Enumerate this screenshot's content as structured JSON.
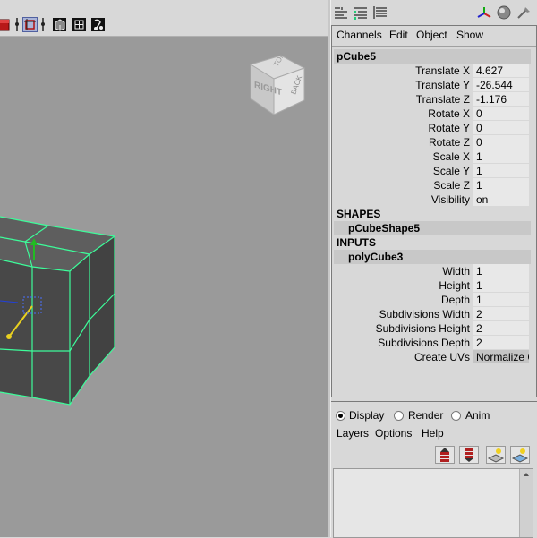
{
  "viewcube": {
    "face_label": "RIGHT"
  },
  "channel_box": {
    "menus": [
      "Channels",
      "Edit",
      "Object",
      "Show"
    ],
    "object_name": "pCube5",
    "transform_attrs": [
      {
        "label": "Translate X",
        "value": "4.627"
      },
      {
        "label": "Translate Y",
        "value": "-26.544"
      },
      {
        "label": "Translate Z",
        "value": "-1.176"
      },
      {
        "label": "Rotate X",
        "value": "0"
      },
      {
        "label": "Rotate Y",
        "value": "0"
      },
      {
        "label": "Rotate Z",
        "value": "0"
      },
      {
        "label": "Scale X",
        "value": "1"
      },
      {
        "label": "Scale Y",
        "value": "1"
      },
      {
        "label": "Scale Z",
        "value": "1"
      },
      {
        "label": "Visibility",
        "value": "on"
      }
    ],
    "shapes_label": "SHAPES",
    "shape_name": "pCubeShape5",
    "inputs_label": "INPUTS",
    "input_name": "polyCube3",
    "input_attrs": [
      {
        "label": "Width",
        "value": "1"
      },
      {
        "label": "Height",
        "value": "1"
      },
      {
        "label": "Depth",
        "value": "1"
      },
      {
        "label": "Subdivisions Width",
        "value": "2"
      },
      {
        "label": "Subdivisions Height",
        "value": "2"
      },
      {
        "label": "Subdivisions Depth",
        "value": "2"
      },
      {
        "label": "Create UVs",
        "value": "Normalize C"
      }
    ]
  },
  "layer_box": {
    "radios": [
      {
        "label": "Display",
        "checked": true
      },
      {
        "label": "Render",
        "checked": false
      },
      {
        "label": "Anim",
        "checked": false
      }
    ],
    "menus": [
      "Layers",
      "Options",
      "Help"
    ]
  },
  "colors": {
    "viewport_bg": "#9a9a9a",
    "mesh_face": "#4a4a4a",
    "wireframe": "#3dfc9a",
    "panel_bg": "#d8d8d8"
  },
  "icons": {
    "toolbar": [
      "red-cube-icon",
      "separator-icon",
      "select-camera-icon",
      "separator-icon",
      "shaded-cube-icon",
      "grid-cube-icon",
      "smooth-tool-icon"
    ],
    "panel_top": [
      "channel-box-icon",
      "attribute-editor-icon",
      "tool-settings-icon",
      "axis-icon",
      "sphere-shade-icon",
      "pin-icon"
    ],
    "layer_buttons": [
      "move-layer-up-icon",
      "move-layer-down-icon",
      "new-layer-icon",
      "new-layer-selected-icon"
    ]
  }
}
